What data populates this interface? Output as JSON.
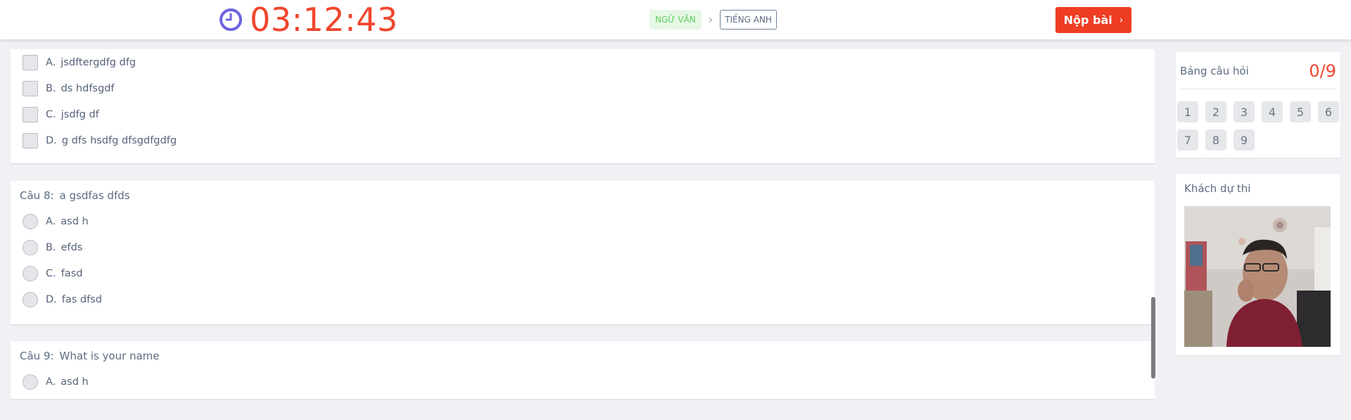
{
  "header": {
    "timer": "03:12:43",
    "subject_active": "NGỮ VĂN",
    "subject_next": "TIẾNG ANH",
    "submit_label": "Nộp bài",
    "submit_arrow": "›"
  },
  "questions": [
    {
      "options": [
        {
          "letter": "A.",
          "text": "jsdftergdfg dfg"
        },
        {
          "letter": "B.",
          "text": "ds hdfsgdf"
        },
        {
          "letter": "C.",
          "text": "jsdfg df"
        },
        {
          "letter": "D.",
          "text": "g dfs hsdfg dfsgdfgdfg"
        }
      ]
    },
    {
      "number": "Câu 8:",
      "text": "a gsdfas dfds",
      "options": [
        {
          "letter": "A.",
          "text": "asd h"
        },
        {
          "letter": "B.",
          "text": "efds"
        },
        {
          "letter": "C.",
          "text": "fasd"
        },
        {
          "letter": "D.",
          "text": "fas dfsd"
        }
      ]
    },
    {
      "number": "Câu 9:",
      "text": "What is your name",
      "options": [
        {
          "letter": "A.",
          "text": "asd h"
        }
      ]
    }
  ],
  "sidebar": {
    "board_title": "Bảng câu hỏi",
    "progress": "0/9",
    "numbers": [
      "1",
      "2",
      "3",
      "4",
      "5",
      "6",
      "7",
      "8",
      "9"
    ],
    "camera_title": "Khách dự thi"
  },
  "colors": {
    "accent_red": "#ee3d23",
    "timer_red": "#f0462e",
    "clock_purple": "#6c63e0",
    "subject_green": "#5ccf5a"
  },
  "icons": {
    "clock": "clock-icon",
    "chevron": "chevron-right-icon"
  }
}
